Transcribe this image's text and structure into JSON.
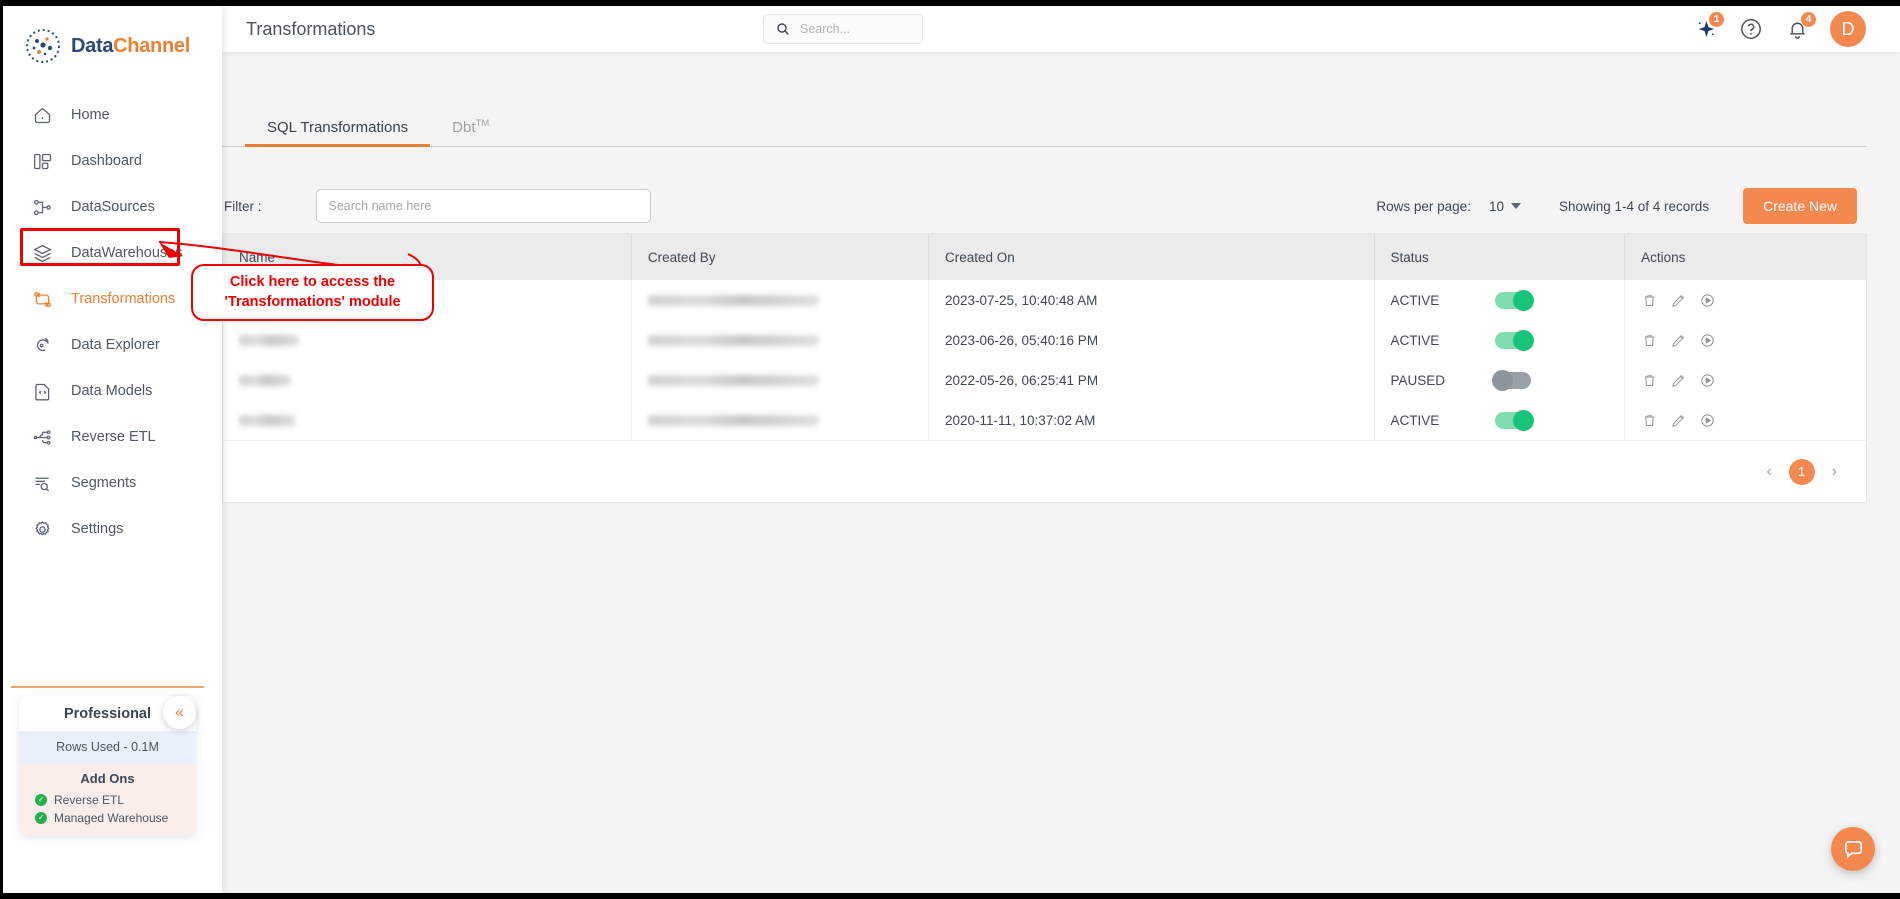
{
  "brand": {
    "part1": "Data",
    "part2": "Channel",
    "logo_icon": "datachannel-logo-icon"
  },
  "sidebar": {
    "items": [
      {
        "label": "Home",
        "icon": "home-icon",
        "active": false
      },
      {
        "label": "Dashboard",
        "icon": "dashboard-icon",
        "active": false
      },
      {
        "label": "DataSources",
        "icon": "datasources-icon",
        "active": false
      },
      {
        "label": "DataWarehouses",
        "icon": "datawarehouses-icon",
        "active": false
      },
      {
        "label": "Transformations",
        "icon": "transformations-icon",
        "active": true
      },
      {
        "label": "Data Explorer",
        "icon": "data-explorer-icon",
        "active": false
      },
      {
        "label": "Data Models",
        "icon": "data-models-icon",
        "active": false
      },
      {
        "label": "Reverse ETL",
        "icon": "reverse-etl-icon",
        "active": false
      },
      {
        "label": "Segments",
        "icon": "segments-icon",
        "active": false
      },
      {
        "label": "Settings",
        "icon": "settings-gear-icon",
        "active": false
      }
    ],
    "plan": {
      "title": "Professional",
      "rows_used": "Rows Used - 0.1M",
      "addons_title": "Add Ons",
      "addons": [
        {
          "label": "Reverse ETL"
        },
        {
          "label": "Managed Warehouse"
        }
      ]
    },
    "collapse_label": "«"
  },
  "header": {
    "title": "Transformations",
    "search_placeholder": "Search...",
    "ai_badge": "1",
    "notification_badge": "4",
    "avatar_initial": "D"
  },
  "tabs": [
    {
      "label": "SQL Transformations",
      "sup": "",
      "active": true
    },
    {
      "label": "Dbt",
      "sup": "TM",
      "active": false
    }
  ],
  "toolbar": {
    "filter_label": "Filter :",
    "filter_placeholder": "Search name here",
    "filter_value": "",
    "rows_per_page_label": "Rows per page:",
    "rows_per_page_value": "10",
    "showing_text": "Showing 1-4 of 4 records",
    "create_button": "Create New"
  },
  "table": {
    "columns": [
      "Name",
      "Created By",
      "Created On",
      "Status",
      "Actions"
    ],
    "rows": [
      {
        "name": "",
        "created_by": "",
        "created_on": "2023-07-25, 10:40:48 AM",
        "status": "ACTIVE",
        "toggle": "on",
        "name_w": 0,
        "by_w": 0
      },
      {
        "name": "",
        "created_by": "",
        "created_on": "2023-06-26, 05:40:16 PM",
        "status": "ACTIVE",
        "toggle": "on",
        "name_w": 60,
        "by_w": 160
      },
      {
        "name": "",
        "created_by": "",
        "created_on": "2022-05-26, 06:25:41 PM",
        "status": "PAUSED",
        "toggle": "off",
        "name_w": 52,
        "by_w": 160
      },
      {
        "name": "",
        "created_by": "",
        "created_on": "2020-11-11, 10:37:02 AM",
        "status": "ACTIVE",
        "toggle": "on",
        "name_w": 56,
        "by_w": 160
      }
    ],
    "action_icons": [
      "delete-icon",
      "edit-icon",
      "run-icon"
    ]
  },
  "pagination": {
    "prev": "‹",
    "current_page": "1",
    "next": "›"
  },
  "annotation": {
    "line1": "Click here to access the",
    "line2": "'Transformations' module",
    "color": "#ef0000"
  },
  "colors": {
    "accent_orange": "#f5884f",
    "brand_blue": "#2b4a74",
    "toggle_on": "#19c37d",
    "toggle_off": "#8e949c",
    "annotation_red": "#ef0000"
  }
}
